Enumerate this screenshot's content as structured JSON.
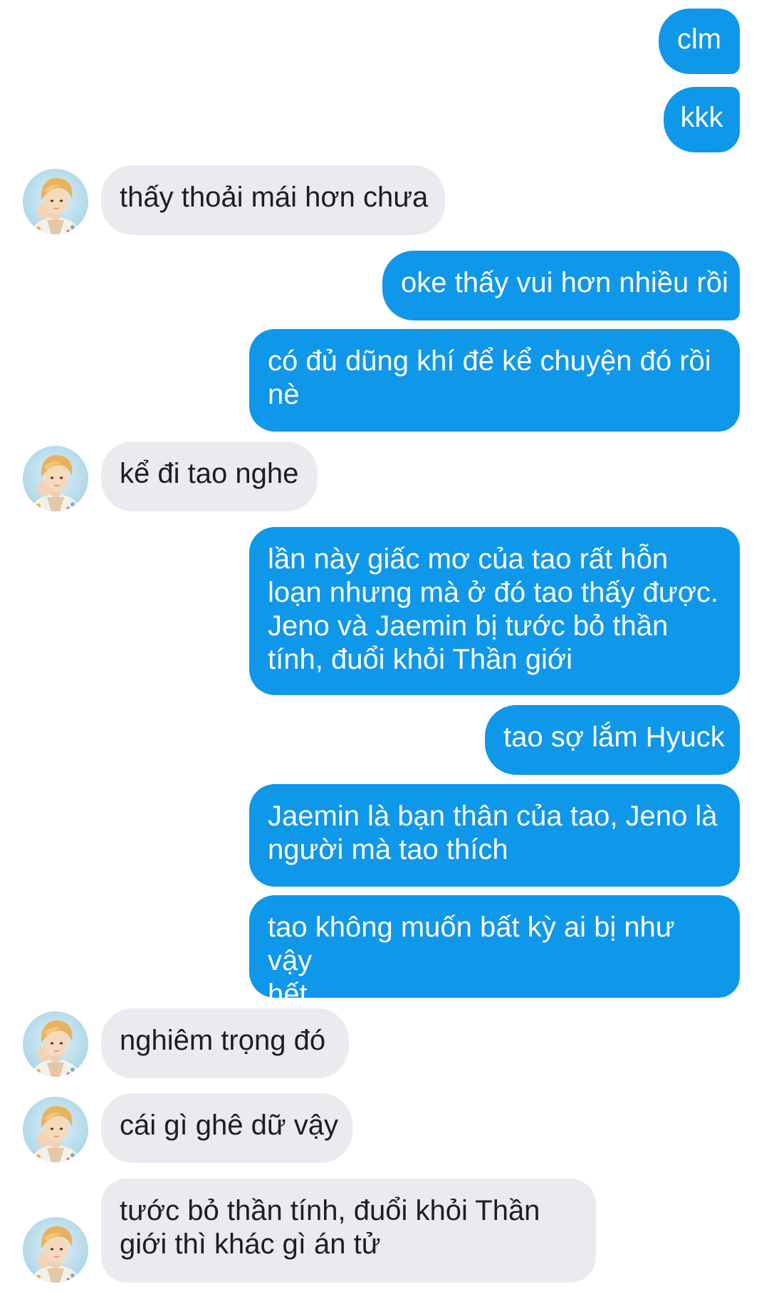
{
  "conversation": {
    "messages": [
      {
        "sender": "me",
        "text": "clm"
      },
      {
        "sender": "me",
        "text": "kkk"
      },
      {
        "sender": "them",
        "text": "thấy thoải mái hơn chưa"
      },
      {
        "sender": "me",
        "text": "oke thấy vui hơn nhiều rồi"
      },
      {
        "sender": "me",
        "text": "có đủ dũng khí để kể chuyện đó rồi\nnè"
      },
      {
        "sender": "them",
        "text": "kể đi tao nghe"
      },
      {
        "sender": "me",
        "text": "lần này giấc mơ của tao rất hỗn\nloạn nhưng mà ở đó tao thấy được.\nJeno và Jaemin bị tước bỏ thần\ntính, đuổi khỏi Thần giới"
      },
      {
        "sender": "me",
        "text": "tao sợ lắm Hyuck"
      },
      {
        "sender": "me",
        "text": "Jaemin là bạn thân của tao, Jeno là\nngười mà tao thích"
      },
      {
        "sender": "me",
        "text": "tao không muốn bất kỳ ai bị như vậy\nhết"
      },
      {
        "sender": "them",
        "text": "nghiêm trọng đó"
      },
      {
        "sender": "them",
        "text": "cái gì ghê dữ vậy"
      },
      {
        "sender": "them",
        "text": "tước bỏ thần tính, đuổi khỏi Thần\ngiới thì khác gì án tử"
      }
    ]
  },
  "colors": {
    "outgoing_bubble": "#0f97ea",
    "incoming_bubble": "#e9ebee",
    "outgoing_text": "#ffffff",
    "incoming_text": "#1c1e21"
  },
  "icons": {
    "contact_avatar": "contact-avatar-photo"
  }
}
